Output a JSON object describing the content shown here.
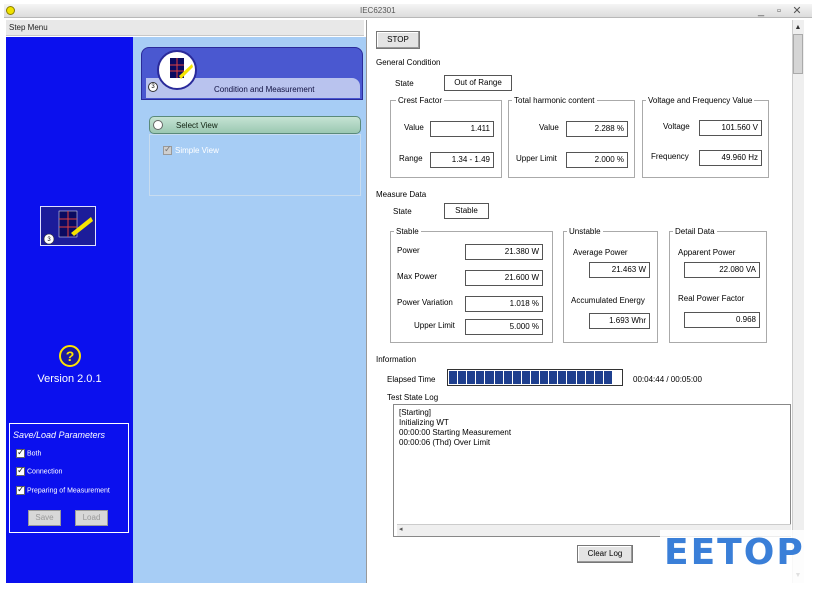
{
  "window": {
    "title": "IEC62301",
    "controls": [
      "_",
      "▫",
      "✕"
    ]
  },
  "step_menu": {
    "label": "Step Menu"
  },
  "sidebar": {
    "version": "Version 2.0.1",
    "save_load": {
      "title": "Save/Load Parameters",
      "options": [
        "Both",
        "Connection",
        "Preparing of Measurement"
      ],
      "save_label": "Save",
      "load_label": "Load"
    }
  },
  "step": {
    "number": "3",
    "label": "Condition and Measurement",
    "select_view": "Select View",
    "simple_view": "Simple View"
  },
  "toolbar": {
    "stop_label": "STOP"
  },
  "general_condition": {
    "title": "General Condition",
    "state_label": "State",
    "state_value": "Out of Range",
    "crest_factor": {
      "title": "Crest Factor",
      "value_label": "Value",
      "value": "1.411",
      "range_label": "Range",
      "range": "1.34 - 1.49"
    },
    "thd": {
      "title": "Total harmonic content",
      "value_label": "Value",
      "value": "2.288 %",
      "upper_label": "Upper Limit",
      "upper": "2.000 %"
    },
    "vf": {
      "title": "Voltage and Frequency Value",
      "voltage_label": "Voltage",
      "voltage": "101.560 V",
      "frequency_label": "Frequency",
      "frequency": "49.960 Hz"
    }
  },
  "measure_data": {
    "title": "Measure Data",
    "state_label": "State",
    "state_value": "Stable",
    "stable": {
      "title": "Stable",
      "power_label": "Power",
      "power": "21.380 W",
      "max_power_label": "Max Power",
      "max_power": "21.600 W",
      "variation_label": "Power Variation",
      "variation": "1.018 %",
      "upper_label": "Upper Limit",
      "upper": "5.000 %"
    },
    "unstable": {
      "title": "Unstable",
      "avg_label": "Average Power",
      "avg": "21.463 W",
      "energy_label": "Accumulated Energy",
      "energy": "1.693 Whr"
    },
    "detail": {
      "title": "Detail Data",
      "apparent_label": "Apparent Power",
      "apparent": "22.080 VA",
      "pf_label": "Real Power Factor",
      "pf": "0.968"
    }
  },
  "information": {
    "title": "Information",
    "elapsed_label": "Elapsed Time",
    "elapsed_value": "00:04:44 / 00:05:00",
    "progress": 0.947,
    "log_title": "Test State Log",
    "log_lines": [
      "[Starting]",
      "Initializing WT",
      "00:00:00 Starting Measurement",
      "00:00:06 (Thd) Over Limit"
    ],
    "clear_label": "Clear Log"
  },
  "watermark": {
    "text": "EETOP"
  },
  "colors": {
    "sidebar_blue": "#0b10ee",
    "panel_light_blue": "#a7cdf5",
    "progress_fill": "#1e3f8f"
  }
}
